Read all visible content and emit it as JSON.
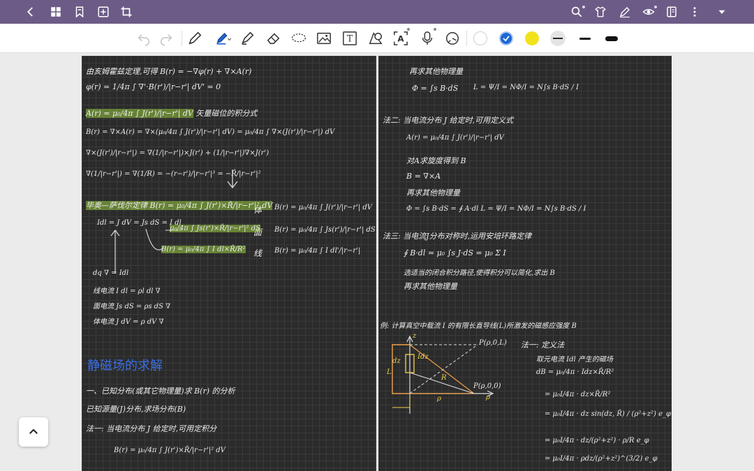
{
  "topbar": {
    "left_icons": [
      "back-icon",
      "grid-icon",
      "bookmark-icon",
      "add-page-icon",
      "crop-icon"
    ],
    "right_icons": [
      "search-icon",
      "shirt-icon",
      "pen-sign-icon",
      "eye-icon",
      "page-layout-icon",
      "more-vertical-icon",
      "dropdown-arrow-icon"
    ]
  },
  "toolbar": {
    "tools": [
      "undo-icon",
      "redo-icon",
      "pen-icon",
      "highlighter-pen-icon",
      "marker-icon",
      "eraser-icon",
      "lasso-icon",
      "image-icon",
      "text-box-icon",
      "shape-icon",
      "ocr-text-icon",
      "mic-icon",
      "timer-icon"
    ],
    "text_tool_glyph": "T",
    "ocr_tool_glyph": "A",
    "colors": [
      "#ffffff",
      "#1e67d6",
      "#f2e21c",
      "#2a2a2a"
    ],
    "selected_color": "#1e67d6"
  },
  "notes_left": {
    "l1": "由亥姆霍兹定理,可得 B(r) = −∇φ(r) + ∇×A(r)",
    "l2": "φ(r) = 1/4π ∫ ∇'·B(r')/|r−r'| dV' = 0",
    "l3": "A(r) = μ₀/4π ∫ J(r')/|r−r'| dV",
    "l3b": "矢量磁位的积分式",
    "l4": "B(r) = ∇×A(r) = ∇×(μ₀/4π ∫ J(r')/|r−r'| dV) = μ₀/4π ∫ ∇×(J(r')/|r−r'|) dV",
    "l5": "∇×(J(r')/|r−r'|) = ∇(1/|r−r'|)×J(r') + (1/|r−r'|)∇×J(r')",
    "l6": "∇(1/|r−r'|) = ∇(1/R) = −(r−r')/|r−r'|³ = −R̂/|r−r'|²",
    "l7": "毕奥—萨伐尔定律  B(r) = μ₀/4π ∫ J(r')×R̂/|r−r'|² dV",
    "vol_label": "体",
    "vol_eq": "B(r) = μ₀/4π ∫ J(r')/|r−r'| dV",
    "surf_label": "面",
    "surf_eq": "B(r) = μ₀/4π ∫ Js(r')/|r−r'| dS",
    "line_label": "线",
    "line_eq": "B(r) = μ₀/4π ∫ I dl'/|r−r'|",
    "l8": "Idl = J dV = Js dS = I dl",
    "l9": "μ₀/4π ∫ Js(r')×R̂/|r−r'|² dS",
    "l10": "B(r) = μ₀/4π ∫ I dl×R̂/R²",
    "m1": "dq ∇ = Idl",
    "m2": "线电流  I dl = ρl dl ∇",
    "m3": "面电流  Js dS = ρs dS ∇",
    "m4": "体电流  J dV = ρ dV ∇",
    "heading": "静磁场的求解",
    "s1": "一、已知分布(或其它物理量)求 B(r) 的分析",
    "s2": "已知源量(J)分布,求场分布(B)",
    "s3": "法一: 当电流分布 J 给定时,可用定积分",
    "s4": "B(r) = μ₀/4π ∫ J(r')×R̂/|r−r'|² dV"
  },
  "notes_right": {
    "r1": "再求其他物理量",
    "r2": "Φ = ∫s B·dS",
    "r3": "L = Ψ/I = NΦ/I = N∫s B·dS / I",
    "r4": "法二: 当电流分布 J 给定时,可用定义式",
    "r5": "A(r) = μ₀/4π ∫ J(r')/|r−r'| dV",
    "r6": "对A求旋度得到 B",
    "r7": "B = ∇×A",
    "r8": "再求其他物理量",
    "r9": "Φ = ∫s B·dS = ∮ A·dl    L = Ψ/I = NΦ/I = N∫s B·dS / I",
    "r10": "法三: 当电流J分布对称时,运用安培环路定律",
    "r11": "∮ B·dl = μ₀ ∫s J·dS = μ₀ Σ I",
    "r12": "选适当的闭合积分路径,使得积分可以简化,求出 B",
    "r13": "再求其他物理量",
    "ex": "例: 计算真空中载流 I 的有限长直导线(L)所激发的磁感应强度 B",
    "sol": "法一: 定义法",
    "q1": "取元电流 Idl 产生的磁场",
    "q2": "dB = μ₀/4π · Idz×R̂/R²",
    "q3": "= μ₀I/4π · dz×R̂/R²",
    "q4": "= μ₀I/4π · dz sin(dz, R̂) / (ρ²+z²) e_φ",
    "q5": "= μ₀I/4π · dz/(ρ²+z²) · ρ/R e_φ",
    "q6": "= μ₀I/4π · ρdz/(ρ²+z²)^(3/2) e_φ",
    "d_z": "z",
    "d_p1": "P(ρ,0,L)",
    "d_p2": "P(ρ,0,0)",
    "d_rho": "ρ",
    "d_rho2": "ρ",
    "d_L": "L",
    "d_R": "R",
    "d_I": "Idz",
    "d_dz": "dz"
  }
}
